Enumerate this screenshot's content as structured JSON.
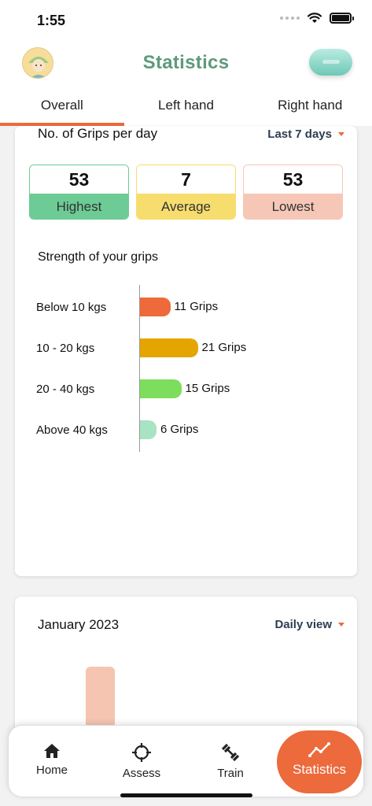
{
  "status_bar": {
    "time": "1:55"
  },
  "header": {
    "title": "Statistics"
  },
  "tabs": [
    {
      "label": "Overall",
      "active": true
    },
    {
      "label": "Left hand",
      "active": false
    },
    {
      "label": "Right hand",
      "active": false
    }
  ],
  "grips_card": {
    "title": "No. of Grips per day",
    "period": "Last 7 days",
    "stats": [
      {
        "value": "53",
        "label": "Highest"
      },
      {
        "value": "7",
        "label": "Average"
      },
      {
        "value": "53",
        "label": "Lowest"
      }
    ],
    "strength_title": "Strength of your grips"
  },
  "chart_data": {
    "type": "bar",
    "orientation": "horizontal",
    "categories": [
      "Below 10 kgs",
      "10 - 20 kgs",
      "20 - 40 kgs",
      "Above 40 kgs"
    ],
    "values": [
      11,
      21,
      15,
      6
    ],
    "value_labels": [
      "11 Grips",
      "21 Grips",
      "15 Grips",
      "6 Grips"
    ],
    "colors": [
      "#ee6a3a",
      "#e5a500",
      "#7ddd5c",
      "#a8e3c4"
    ],
    "title": "Strength of your grips"
  },
  "monthly_card": {
    "title": "January 2023",
    "view": "Daily view"
  },
  "nav": {
    "items": [
      {
        "label": "Home",
        "icon": "home-icon"
      },
      {
        "label": "Assess",
        "icon": "crosshair-icon"
      },
      {
        "label": "Train",
        "icon": "dumbbell-icon"
      },
      {
        "label": "Statistics",
        "icon": "trend-chart-icon",
        "active": true
      }
    ]
  },
  "colors": {
    "accent": "#ec6a3c",
    "brand_green": "#5f9a7c"
  }
}
